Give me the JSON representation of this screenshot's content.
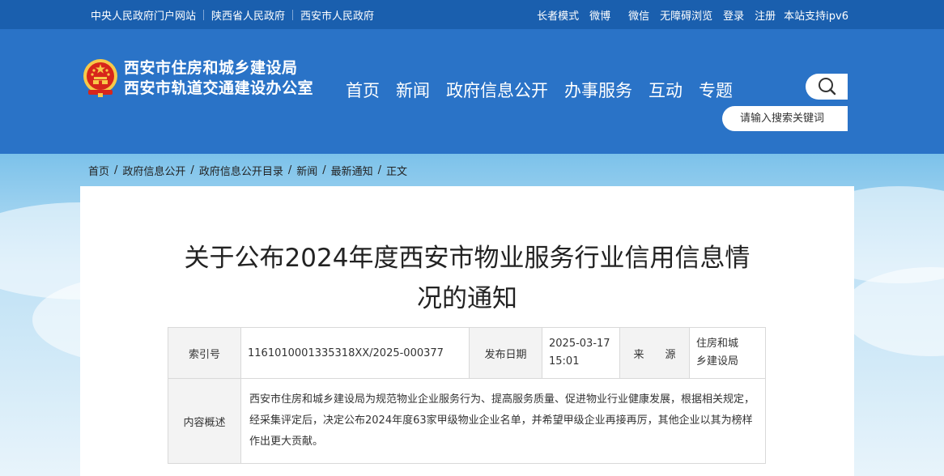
{
  "topbar": {
    "left_links": [
      "中央人民政府门户网站",
      "陕西省人民政府",
      "西安市人民政府"
    ],
    "right_links": [
      "长者模式",
      "微博",
      "微信",
      "无障碍浏览",
      "登录",
      "注册",
      "本站支持ipv6"
    ]
  },
  "header": {
    "site_name_line1": "西安市住房和城乡建设局",
    "site_name_line2": "西安市轨道交通建设办公室",
    "nav": [
      "首页",
      "新闻",
      "政府信息公开",
      "办事服务",
      "互动",
      "专题"
    ],
    "search_placeholder": "请输入搜索关键词"
  },
  "breadcrumb": [
    "首页",
    "政府信息公开",
    "政府信息公开目录",
    "新闻",
    "最新通知",
    "正文"
  ],
  "article": {
    "title_line1": "关于公布2024年度西安市物业服务行业信用信息情",
    "title_line2": "况的通知"
  },
  "meta": {
    "index_label": "索引号",
    "index_value": "1161010001335318XX/2025-000377",
    "date_label": "发布日期",
    "date_value_line1": "2025-03-17",
    "date_value_line2": "15:01",
    "source_label": "来　　源",
    "source_value_line1": "住房和城",
    "source_value_line2": "乡建设局",
    "summary_label": "内容概述",
    "summary_value": "西安市住房和城乡建设局为规范物业企业服务行为、提高服务质量、促进物业行业健康发展，根据相关规定，经采集评定后，决定公布2024年度63家甲级物业企业名单，并希望甲级企业再接再厉，其他企业以其为榜样作出更大贡献。"
  },
  "colors": {
    "topbar": "#1a5fae",
    "header": "#2a73c7",
    "emblem_red": "#d7261b",
    "emblem_gold": "#f7c948"
  }
}
